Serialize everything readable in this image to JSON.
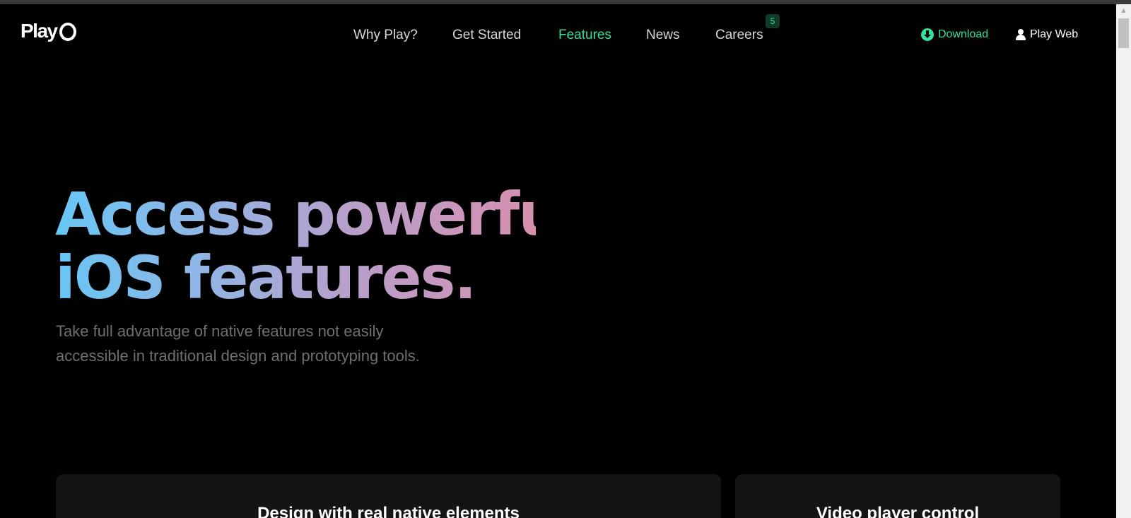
{
  "brand": {
    "logo_text": "Play"
  },
  "nav": {
    "items": [
      {
        "label": "Why Play?"
      },
      {
        "label": "Get Started"
      },
      {
        "label": "Features"
      },
      {
        "label": "News"
      },
      {
        "label": "Careers"
      }
    ],
    "active": "Features",
    "careers_badge": "5"
  },
  "actions": {
    "download_label": "Download",
    "playweb_label": "Play Web"
  },
  "hero": {
    "title_line1": "Access powerful",
    "title_line2": "iOS features.",
    "subtitle_line1": "Take full advantage of native features not easily",
    "subtitle_line2": "accessible in traditional design and prototyping tools."
  },
  "cards": [
    {
      "title": "Design with real native elements"
    },
    {
      "title": "Video player control"
    }
  ],
  "colors": {
    "accent": "#35e09a",
    "background": "#000000",
    "card": "#141414",
    "gradient_start": "#67c6f5",
    "gradient_end": "#d690b0"
  },
  "icons": {
    "download": "download-icon",
    "user": "user-icon",
    "scroll_up": "arrow-up-icon"
  }
}
